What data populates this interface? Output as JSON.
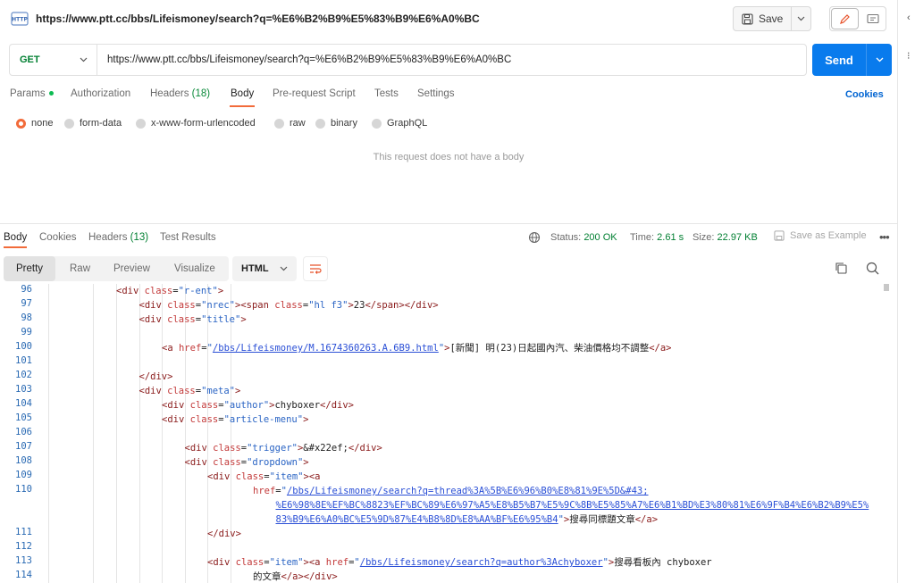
{
  "header": {
    "title": "https://www.ptt.cc/bbs/Lifeismoney/search?q=%E6%B2%B9%E5%83%B9%E6%A0%BC",
    "save_label": "Save",
    "http_badge": "HTTP"
  },
  "request": {
    "method": "GET",
    "url": "https://www.ptt.cc/bbs/Lifeismoney/search?q=%E6%B2%B9%E5%83%B9%E6%A0%BC",
    "send_label": "Send"
  },
  "req_tabs": {
    "params": "Params",
    "authorization": "Authorization",
    "headers": "Headers",
    "headers_count": "(18)",
    "body": "Body",
    "prerequest": "Pre-request Script",
    "tests": "Tests",
    "settings": "Settings",
    "cookies": "Cookies"
  },
  "body_types": {
    "none": "none",
    "form_data": "form-data",
    "urlencoded": "x-www-form-urlencoded",
    "raw": "raw",
    "binary": "binary",
    "graphql": "GraphQL",
    "selected": "none"
  },
  "no_body_message": "This request does not have a body",
  "response": {
    "tabs": {
      "body": "Body",
      "cookies": "Cookies",
      "headers": "Headers",
      "headers_count": "(13)",
      "test_results": "Test Results"
    },
    "status_label": "Status:",
    "status_value": "200 OK",
    "time_label": "Time:",
    "time_value": "2.61 s",
    "size_label": "Size:",
    "size_value": "22.97 KB",
    "save_example": "Save as Example",
    "views": {
      "pretty": "Pretty",
      "raw": "Raw",
      "preview": "Preview",
      "visualize": "Visualize"
    },
    "format": "HTML"
  },
  "code_lines": [
    {
      "n": "96",
      "indent": 1,
      "html": "<span class='tag'>&lt;div</span> <span class='attr'>class</span>=<span class='val'>\"r-ent\"</span><span class='tag'>&gt;</span>"
    },
    {
      "n": "97",
      "indent": 2,
      "html": "<span class='tag'>&lt;div</span> <span class='attr'>class</span>=<span class='val'>\"nrec\"</span><span class='tag'>&gt;&lt;span</span> <span class='attr'>class</span>=<span class='val'>\"hl f3\"</span><span class='tag'>&gt;</span>23<span class='tag'>&lt;/span&gt;&lt;/div&gt;</span>"
    },
    {
      "n": "98",
      "indent": 2,
      "html": "<span class='tag'>&lt;div</span> <span class='attr'>class</span>=<span class='val'>\"title\"</span><span class='tag'>&gt;</span>"
    },
    {
      "n": "99",
      "indent": 0,
      "html": ""
    },
    {
      "n": "100",
      "indent": 3,
      "html": "<span class='tag'>&lt;a</span> <span class='attr'>href</span>=<span class='val'>\"</span><span class='lnk'>/bbs/Lifeismoney/M.1674360263.A.6B9.html</span><span class='val'>\"</span><span class='tag'>&gt;</span>[新聞] 明(23)日起國內汽、柴油價格均不調整<span class='tag'>&lt;/a&gt;</span>"
    },
    {
      "n": "101",
      "indent": 0,
      "html": ""
    },
    {
      "n": "102",
      "indent": 2,
      "html": "<span class='tag'>&lt;/div&gt;</span>"
    },
    {
      "n": "103",
      "indent": 2,
      "html": "<span class='tag'>&lt;div</span> <span class='attr'>class</span>=<span class='val'>\"meta\"</span><span class='tag'>&gt;</span>"
    },
    {
      "n": "104",
      "indent": 3,
      "html": "<span class='tag'>&lt;div</span> <span class='attr'>class</span>=<span class='val'>\"author\"</span><span class='tag'>&gt;</span>chyboxer<span class='tag'>&lt;/div&gt;</span>"
    },
    {
      "n": "105",
      "indent": 3,
      "html": "<span class='tag'>&lt;div</span> <span class='attr'>class</span>=<span class='val'>\"article-menu\"</span><span class='tag'>&gt;</span>"
    },
    {
      "n": "106",
      "indent": 0,
      "html": ""
    },
    {
      "n": "107",
      "indent": 4,
      "html": "<span class='tag'>&lt;div</span> <span class='attr'>class</span>=<span class='val'>\"trigger\"</span><span class='tag'>&gt;</span>&amp;#x22ef;<span class='tag'>&lt;/div&gt;</span>"
    },
    {
      "n": "108",
      "indent": 4,
      "html": "<span class='tag'>&lt;div</span> <span class='attr'>class</span>=<span class='val'>\"dropdown\"</span><span class='tag'>&gt;</span>"
    },
    {
      "n": "109",
      "indent": 5,
      "html": "<span class='tag'>&lt;div</span> <span class='attr'>class</span>=<span class='val'>\"item\"</span><span class='tag'>&gt;&lt;a</span>"
    },
    {
      "n": "110",
      "indent": 7,
      "html": "<span class='attr'>href</span>=<span class='val'>\"</span><span class='lnk'>/bbs/Lifeismoney/search?q=thread%3A%5B%E6%96%B0%E8%81%9E%5D&amp;#43;</span>"
    },
    {
      "n": "",
      "indent": 8,
      "html": "<span class='lnk'>%E6%98%8E%EF%BC%8823%EF%BC%89%E6%97%A5%E8%B5%B7%E5%9C%8B%E5%85%A7%E6%B1%BD%E3%80%81%E6%9F%B4%E6%B2%B9%E5%</span>"
    },
    {
      "n": "",
      "indent": 8,
      "html": "<span class='lnk'>83%B9%E6%A0%BC%E5%9D%87%E4%B8%8D%E8%AA%BF%E6%95%B4</span><span class='val'>\"</span><span class='tag'>&gt;</span>搜尋同標題文章<span class='tag'>&lt;/a&gt;</span>"
    },
    {
      "n": "111",
      "indent": 5,
      "html": "<span class='tag'>&lt;/div&gt;</span>"
    },
    {
      "n": "112",
      "indent": 0,
      "html": ""
    },
    {
      "n": "113",
      "indent": 5,
      "html": "<span class='tag'>&lt;div</span> <span class='attr'>class</span>=<span class='val'>\"item\"</span><span class='tag'>&gt;&lt;a</span> <span class='attr'>href</span>=<span class='val'>\"</span><span class='lnk'>/bbs/Lifeismoney/search?q=author%3Achyboxer</span><span class='val'>\"</span><span class='tag'>&gt;</span>搜尋看板內 chyboxer"
    },
    {
      "n": "114",
      "indent": 7,
      "html": "的文章<span class='tag'>&lt;/a&gt;&lt;/div&gt;</span>"
    }
  ]
}
